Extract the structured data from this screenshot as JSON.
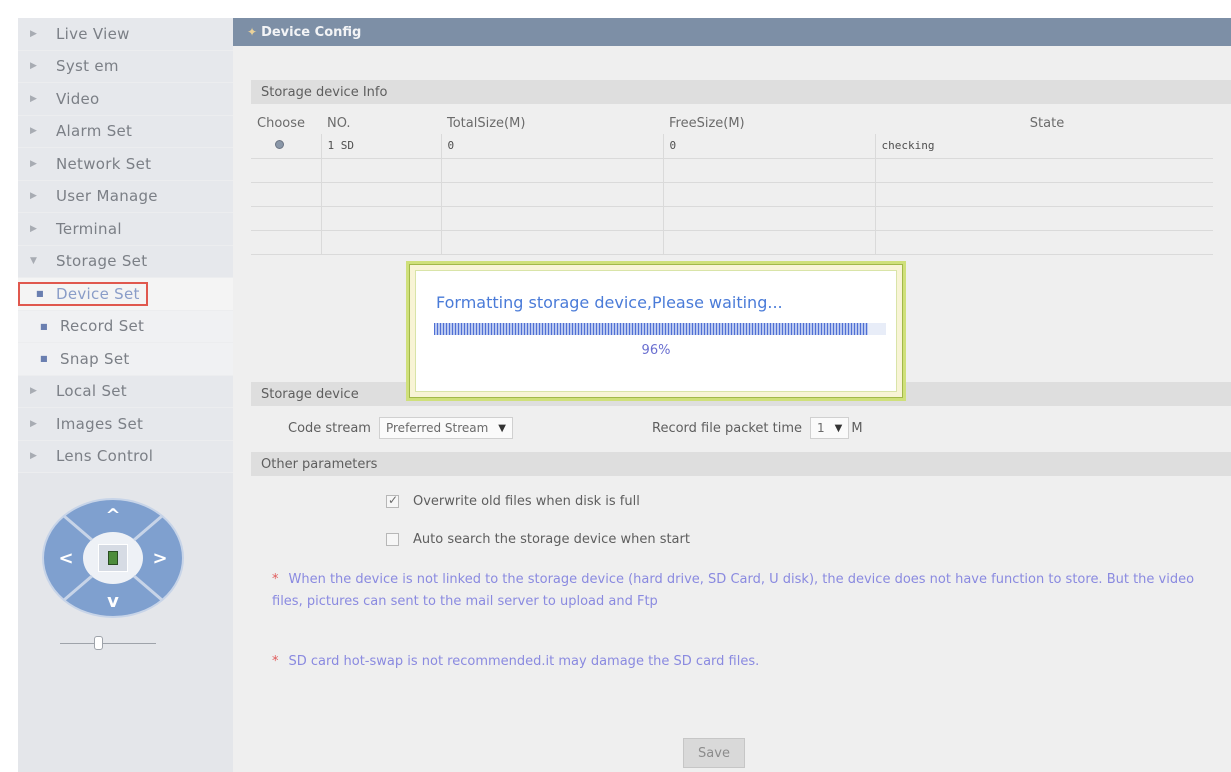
{
  "sidebar": {
    "items": [
      {
        "label": "Live View"
      },
      {
        "label": "Syst em"
      },
      {
        "label": "Video"
      },
      {
        "label": "Alarm Set"
      },
      {
        "label": "Network Set"
      },
      {
        "label": "User Manage"
      },
      {
        "label": "Terminal"
      },
      {
        "label": "Storage Set"
      },
      {
        "label": "Device Set"
      },
      {
        "label": "Record Set"
      },
      {
        "label": "Snap Set"
      },
      {
        "label": "Local Set"
      },
      {
        "label": "Images Set"
      },
      {
        "label": "Lens Control"
      }
    ]
  },
  "ptz": {
    "up": "^",
    "down": "v",
    "left": "<",
    "right": ">"
  },
  "titlebar": {
    "title": "Device Config"
  },
  "storage_info": {
    "header": "Storage device Info",
    "columns": [
      "Choose",
      "NO.",
      "TotalSize(M)",
      "FreeSize(M)",
      "State"
    ],
    "rows": [
      {
        "no": "1 SD",
        "total": "0",
        "free": "0",
        "state": "checking"
      }
    ]
  },
  "storage_params": {
    "header": "Storage device",
    "code_stream_label": "Code stream",
    "code_stream_value": "Preferred Stream",
    "packet_time_label": "Record file packet time",
    "packet_time_value": "1",
    "packet_time_unit": "M"
  },
  "other_params": {
    "header": "Other parameters",
    "overwrite_label": "Overwrite old files when disk is full",
    "overwrite_checked": true,
    "autosearch_label": "Auto search the storage device when start",
    "autosearch_checked": false
  },
  "notes": {
    "note1": "When the device is not linked to the storage device (hard drive, SD Card, U disk), the device does not have function to store. But the video files, pictures can sent to the mail server to upload and Ftp",
    "note2": "SD card hot-swap is not recommended.it may damage the SD card files.",
    "star": "*"
  },
  "save_label": "Save",
  "modal": {
    "message": "Formatting storage device,Please waiting...",
    "progress_percent": 96,
    "progress_text": "96%"
  },
  "colors": {
    "titlebar": "#7d8fa6",
    "highlight_border": "#e0584e",
    "modal_text": "#4a7bd8",
    "note_text": "#8a8ae0"
  }
}
